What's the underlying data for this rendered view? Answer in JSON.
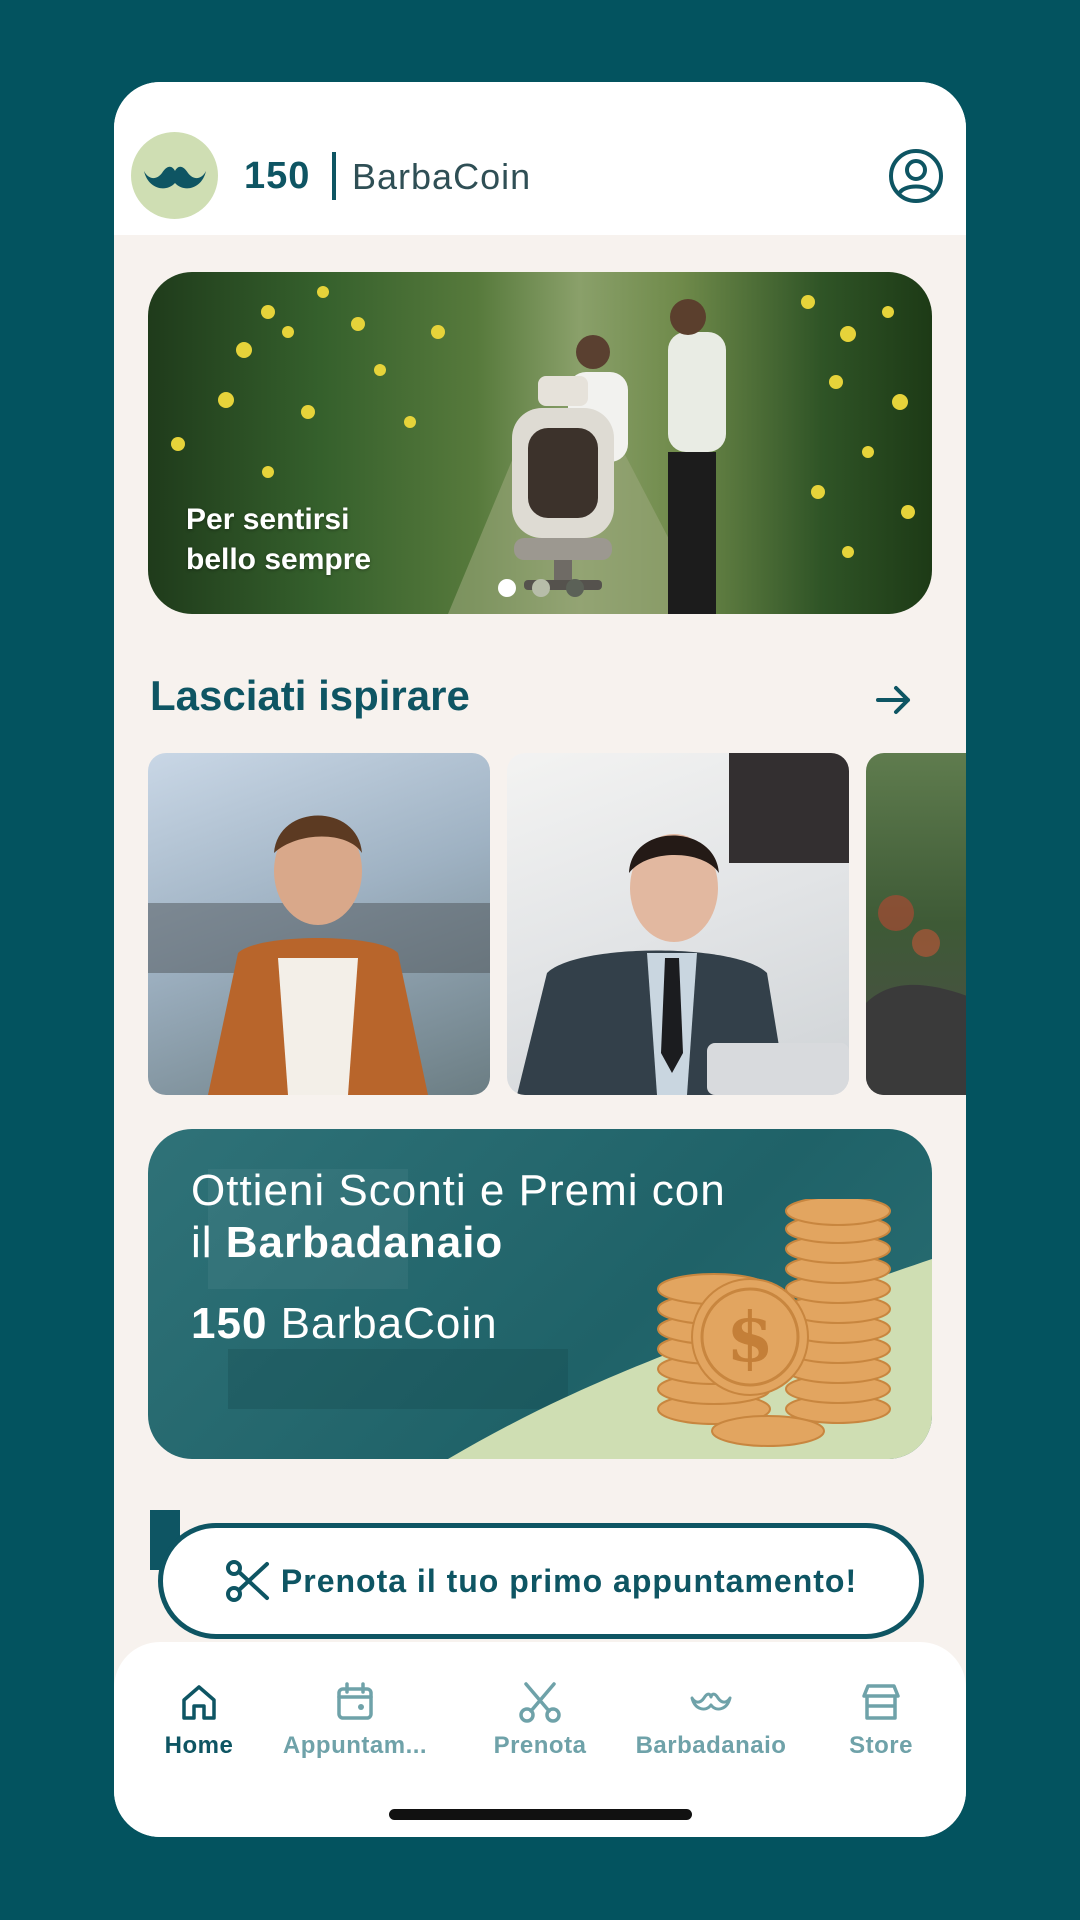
{
  "header": {
    "coin_count": "150",
    "coin_label": "BarbaCoin",
    "logo_icon": "mustache-icon",
    "profile_icon": "user-circle-icon"
  },
  "hero": {
    "line1": "Per sentirsi",
    "line2": "bello sempre",
    "slides": 3,
    "active_slide": 1
  },
  "inspiration": {
    "title": "Lasciati ispirare",
    "arrow_icon": "arrow-right-icon"
  },
  "rewards": {
    "title_line1": "Ottieni Sconti e Premi con",
    "title_line2_prefix": "il ",
    "title_line2_bold": "Barbadanaio",
    "coins_amount": "150",
    "coins_label": "BarbaCoin"
  },
  "cta": {
    "label": "Prenota il tuo primo appuntamento!",
    "icon": "scissors-icon"
  },
  "nav": {
    "items": [
      {
        "label": "Home",
        "icon": "home-icon",
        "active": true
      },
      {
        "label": "Appuntam...",
        "icon": "calendar-icon",
        "active": false
      },
      {
        "label": "Prenota",
        "icon": "scissors-icon",
        "active": false
      },
      {
        "label": "Barbadanaio",
        "icon": "mustache-icon",
        "active": false
      },
      {
        "label": "Store",
        "icon": "store-icon",
        "active": false
      }
    ]
  },
  "colors": {
    "background": "#03535f",
    "primary": "#0e5563",
    "inactive": "#6fa2a9",
    "surface": "#f7f2ee",
    "accent": "#cfdeb3",
    "coin": "#e2a560"
  }
}
